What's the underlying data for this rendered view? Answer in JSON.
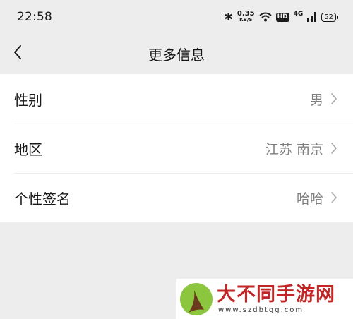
{
  "status_bar": {
    "time": "22:58",
    "bluetooth_icon": "bluetooth-icon",
    "speed_value": "0.35",
    "speed_unit": "KB/S",
    "wifi_icon": "wifi-icon",
    "hd_badge": "HD",
    "network_type": "4G",
    "signal_icon": "signal-icon",
    "battery_level": "52"
  },
  "header": {
    "back_icon": "chevron-left-icon",
    "title": "更多信息"
  },
  "list": {
    "items": [
      {
        "label": "性别",
        "value": "男"
      },
      {
        "label": "地区",
        "value": "江苏 南京"
      },
      {
        "label": "个性签名",
        "value": "哈哈"
      }
    ],
    "chevron_icon": "chevron-right-icon"
  },
  "watermark": {
    "name": "大不同手游网",
    "url": "www.szdbtgg.com",
    "brand_color": "#c22626"
  },
  "colors": {
    "background": "#ededed",
    "card": "#ffffff",
    "secondary_text": "#7f7f7f"
  }
}
